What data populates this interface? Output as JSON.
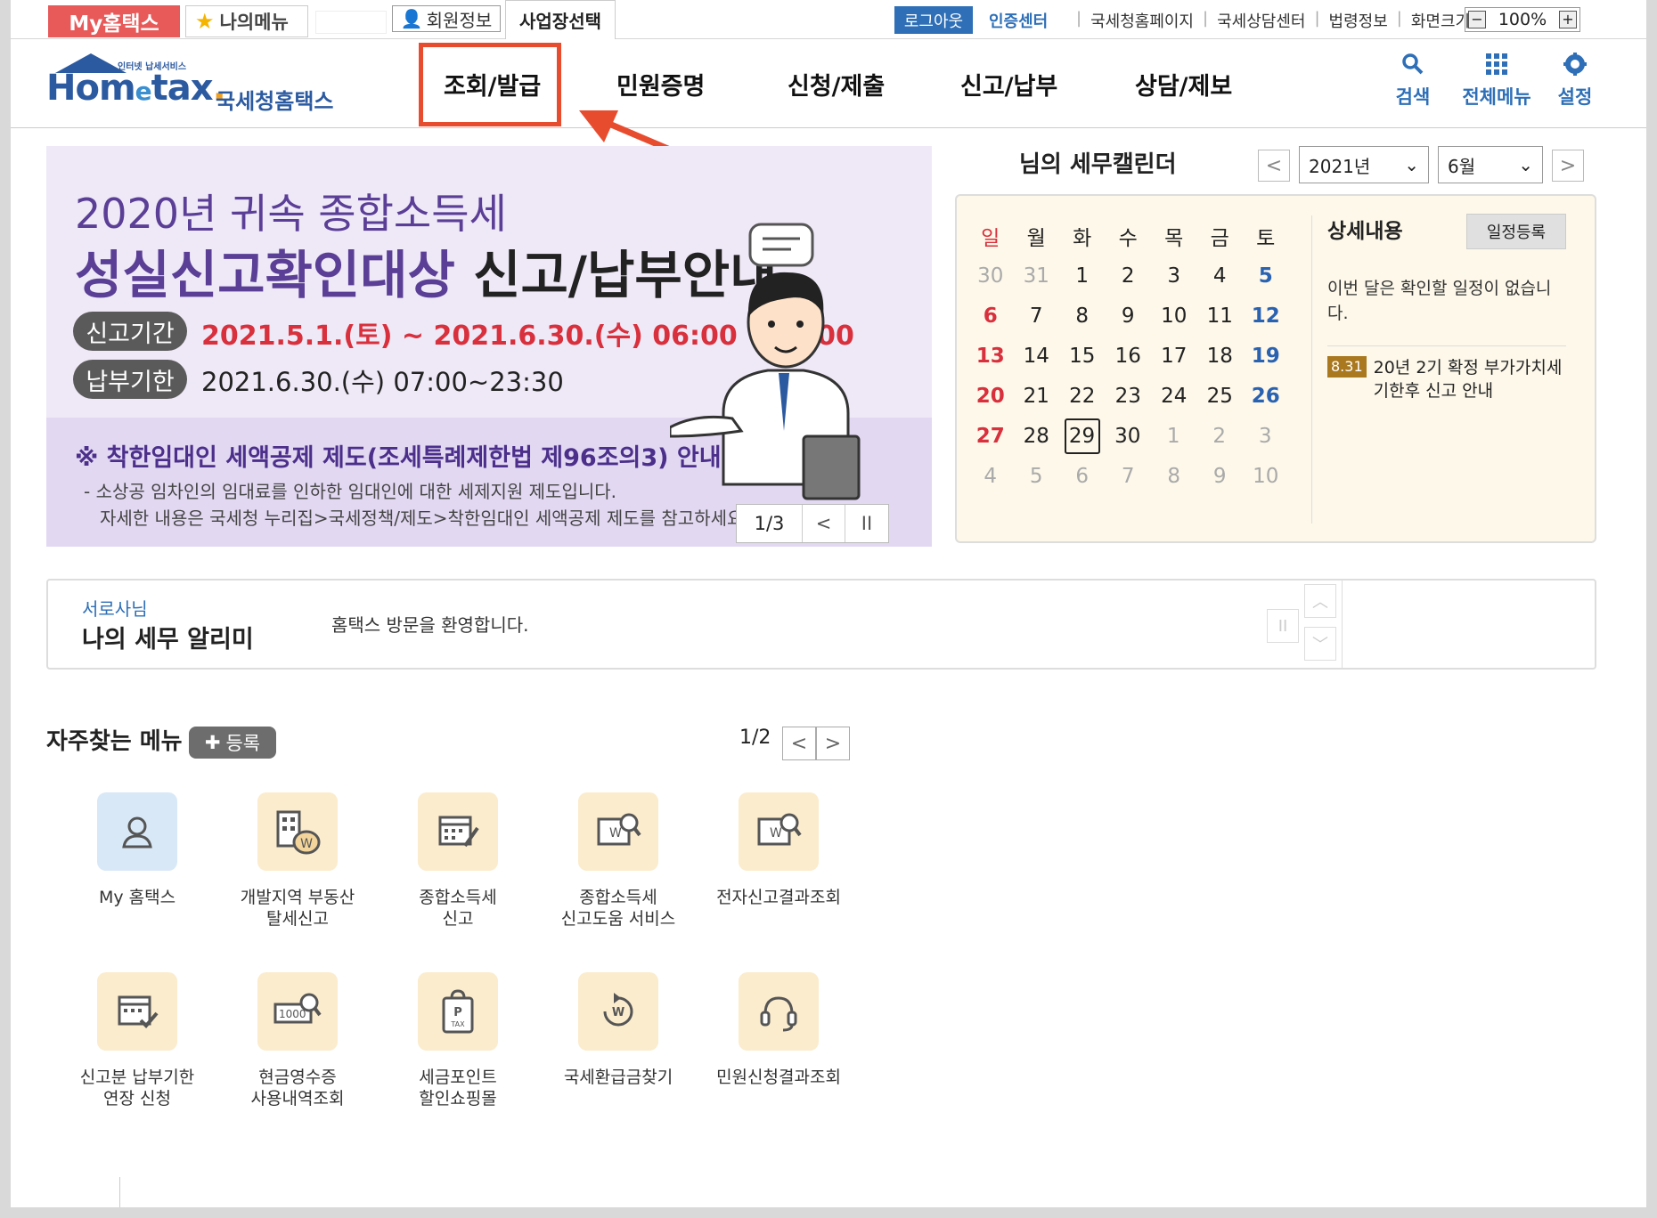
{
  "util": {
    "my_hometax": "My홈택스",
    "my_menu": "나의메뉴",
    "member_info": "회원정보",
    "biz_select": "사업장선택",
    "logout": "로그아웃",
    "cert_center": "인증센터",
    "links": [
      "국세청홈페이지",
      "국세상담센터",
      "법령정보",
      "화면크기"
    ],
    "zoom_minus": "−",
    "zoom_value": "100%",
    "zoom_plus": "+"
  },
  "header": {
    "logo_small": "인터넷 납세서비스",
    "logo_home": "Hom",
    "logo_e": "e",
    "logo_tax": "tax",
    "logo_dot": ".",
    "logo_kor": "국세청홈택스",
    "nav": [
      "조회/발급",
      "민원증명",
      "신청/제출",
      "신고/납부",
      "상담/제보"
    ],
    "icons": [
      {
        "label": "검색",
        "icon": "search-icon"
      },
      {
        "label": "전체메뉴",
        "icon": "grid-icon"
      },
      {
        "label": "설정",
        "icon": "gear-icon"
      }
    ]
  },
  "banner": {
    "line1": "2020년 귀속 종합소득세",
    "line2a": "성실신고확인대상",
    "line2b": " 신고/납부안내",
    "pill1": "신고기간",
    "date1": "2021.5.1.(토) ~ 2021.6.30.(수) 06:00 ~24:00",
    "pill2": "납부기한",
    "date2": "2021.6.30.(수) 07:00~23:30",
    "notice1": "※ 착한임대인 세액공제 제도(조세특례제한법 제96조의3) 안내",
    "notice2": "- 소상공 임차인의 임대료를 인하한 임대인에 대한 세제지원 제도입니다.",
    "notice3": "자세한 내용은 국세청 누리집>국세정책/제도>착한임대인 세액공제 제도를 참고하세요.",
    "page": "1/3",
    "prev": "<",
    "pause": "II"
  },
  "calendar": {
    "title": "님의 세무캘린더",
    "year": "2021년",
    "month": "6월",
    "prev": "<",
    "next": ">",
    "weekdays": [
      "일",
      "월",
      "화",
      "수",
      "목",
      "금",
      "토"
    ],
    "weeks": [
      [
        "30",
        "31",
        "1",
        "2",
        "3",
        "4",
        "5"
      ],
      [
        "6",
        "7",
        "8",
        "9",
        "10",
        "11",
        "12"
      ],
      [
        "13",
        "14",
        "15",
        "16",
        "17",
        "18",
        "19"
      ],
      [
        "20",
        "21",
        "22",
        "23",
        "24",
        "25",
        "26"
      ],
      [
        "27",
        "28",
        "29",
        "30",
        "1",
        "2",
        "3"
      ],
      [
        "4",
        "5",
        "6",
        "7",
        "8",
        "9",
        "10"
      ]
    ],
    "today": "29",
    "detail_title": "상세내용",
    "register": "일정등록",
    "no_schedule": "이번 달은 확인할 일정이 없습니다.",
    "event_badge": "8.31",
    "event_text": "20년 2기 확정 부가가치세 기한후 신고 안내"
  },
  "alarm": {
    "user": "서로사님",
    "title": "나의 세무 알리미",
    "welcome": "홈택스 방문을 환영합니다.",
    "pause": "II",
    "up": "︿",
    "down": "﹀"
  },
  "quick": {
    "title": "자주찾는 메뉴",
    "register": "등록",
    "page": "1/2",
    "prev": "<",
    "next": ">",
    "items": [
      {
        "label": "My 홈택스",
        "icon": "user-icon"
      },
      {
        "label": "개발지역 부동산\n탈세신고",
        "icon": "building-money-icon"
      },
      {
        "label": "종합소득세\n신고",
        "icon": "calendar-pen-icon"
      },
      {
        "label": "종합소득세\n신고도움 서비스",
        "icon": "document-search-icon"
      },
      {
        "label": "전자신고결과조회",
        "icon": "document-search-icon"
      },
      {
        "label": "신고분 납부기한\n연장 신청",
        "icon": "calendar-check-icon"
      },
      {
        "label": "현금영수증\n사용내역조회",
        "icon": "receipt-search-icon"
      },
      {
        "label": "세금포인트\n할인쇼핑몰",
        "icon": "shopping-bag-icon"
      },
      {
        "label": "국세환급금찾기",
        "icon": "refund-icon"
      },
      {
        "label": "민원신청결과조회",
        "icon": "headset-icon"
      }
    ]
  },
  "colors": {
    "highlight": "#e84c2f",
    "brand_blue": "#2e6fb7",
    "banner_purple": "#5b3f96",
    "sunday": "#d8303c",
    "saturday": "#2a62b2"
  }
}
